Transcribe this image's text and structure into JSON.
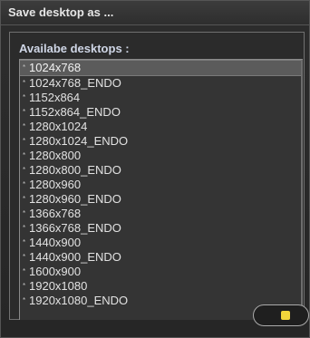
{
  "dialog": {
    "title": "Save desktop as ..."
  },
  "panel": {
    "title": "Availabe desktops :"
  },
  "desktops": [
    {
      "label": "1024x768",
      "selected": true
    },
    {
      "label": "1024x768_ENDO"
    },
    {
      "label": "1152x864"
    },
    {
      "label": "1152x864_ENDO"
    },
    {
      "label": "1280x1024"
    },
    {
      "label": "1280x1024_ENDO"
    },
    {
      "label": "1280x800"
    },
    {
      "label": "1280x800_ENDO"
    },
    {
      "label": "1280x960"
    },
    {
      "label": "1280x960_ENDO"
    },
    {
      "label": "1366x768"
    },
    {
      "label": "1366x768_ENDO"
    },
    {
      "label": "1440x900"
    },
    {
      "label": "1440x900_ENDO"
    },
    {
      "label": "1600x900"
    },
    {
      "label": "1920x1080"
    },
    {
      "label": "1920x1080_ENDO"
    }
  ],
  "colors": {
    "accent": "#f1d43b"
  }
}
